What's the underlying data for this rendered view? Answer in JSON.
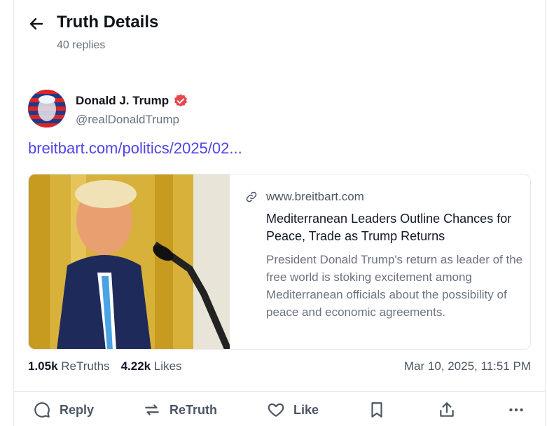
{
  "header": {
    "title": "Truth Details",
    "replies": "40 replies"
  },
  "post": {
    "author_name": "Donald J. Trump",
    "handle": "@realDonaldTrump",
    "link_text": "breitbart.com/politics/2025/02...",
    "card": {
      "domain": "www.breitbart.com",
      "title": "Mediterranean Leaders Outline Chances for Peace, Trade as Trump Returns",
      "description": "President Donald Trump's return as leader of the free world is stoking excitement among Mediterranean officials about the possibility of peace and economic agreements."
    },
    "stats": {
      "retruths_count": "1.05k",
      "retruths_label": "ReTruths",
      "likes_count": "4.22k",
      "likes_label": "Likes"
    },
    "timestamp": "Mar 10, 2025, 11:51 PM"
  },
  "actions": {
    "reply": "Reply",
    "retruth": "ReTruth",
    "like": "Like"
  },
  "colors": {
    "link": "#4f46e5",
    "verified": "#e5484d",
    "muted": "#6b7280"
  },
  "icons": [
    "back-arrow-icon",
    "verified-badge-icon",
    "link-icon",
    "reply-icon",
    "retruth-icon",
    "like-heart-icon",
    "bookmark-icon",
    "share-icon",
    "more-icon"
  ]
}
